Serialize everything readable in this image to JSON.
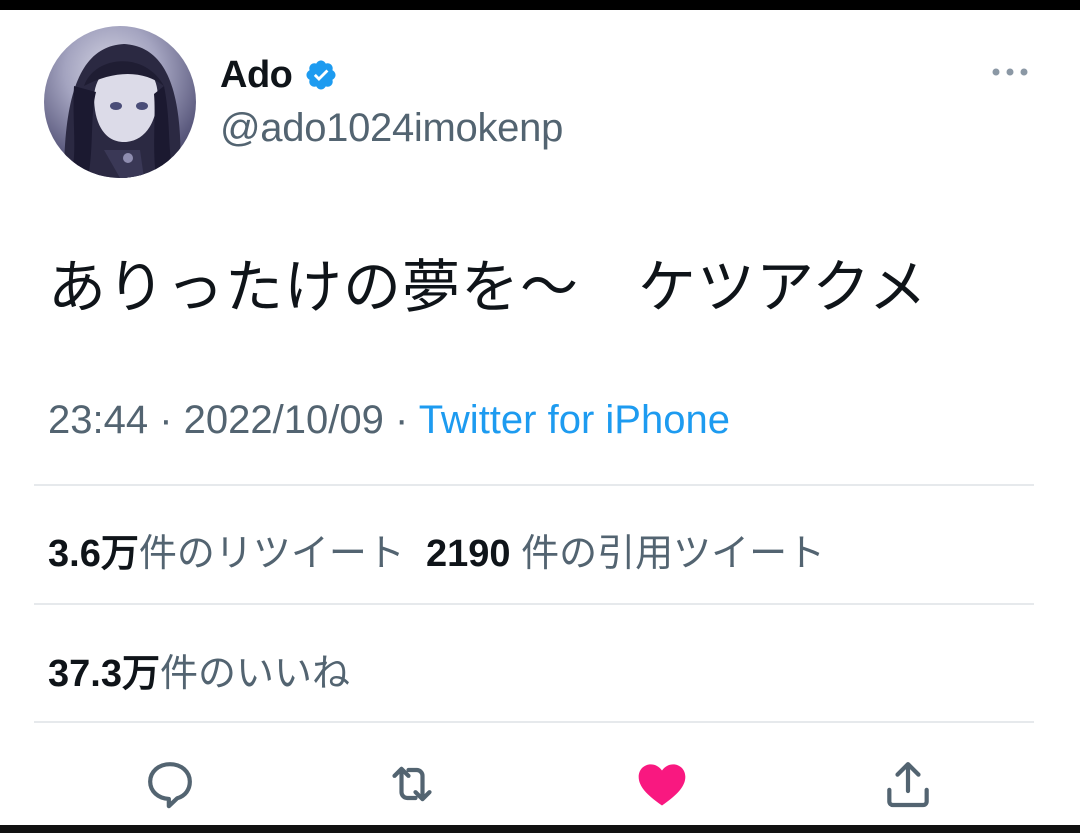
{
  "tweet": {
    "display_name": "Ado",
    "handle": "@ado1024imokenp",
    "text": "ありったけの夢を～　ケツアクメ",
    "time": "23:44",
    "separator": " · ",
    "date": "2022/10/09",
    "source": "Twitter for iPhone"
  },
  "stats": {
    "retweets_count": "3.6万",
    "retweets_label": "件のリツイート",
    "quotes_count": "2190",
    "quotes_label": "件の引用ツイート",
    "likes_count": "37.3万",
    "likes_label": "件のいいね"
  },
  "icons": {
    "verified": "verified-badge-icon",
    "more": "more-icon",
    "reply": "reply-icon",
    "retweet": "retweet-icon",
    "like": "heart-icon",
    "share": "share-icon"
  },
  "colors": {
    "accent": "#1d9bf0",
    "like": "#f91880",
    "text": "#0f1419",
    "secondary": "#536471"
  }
}
